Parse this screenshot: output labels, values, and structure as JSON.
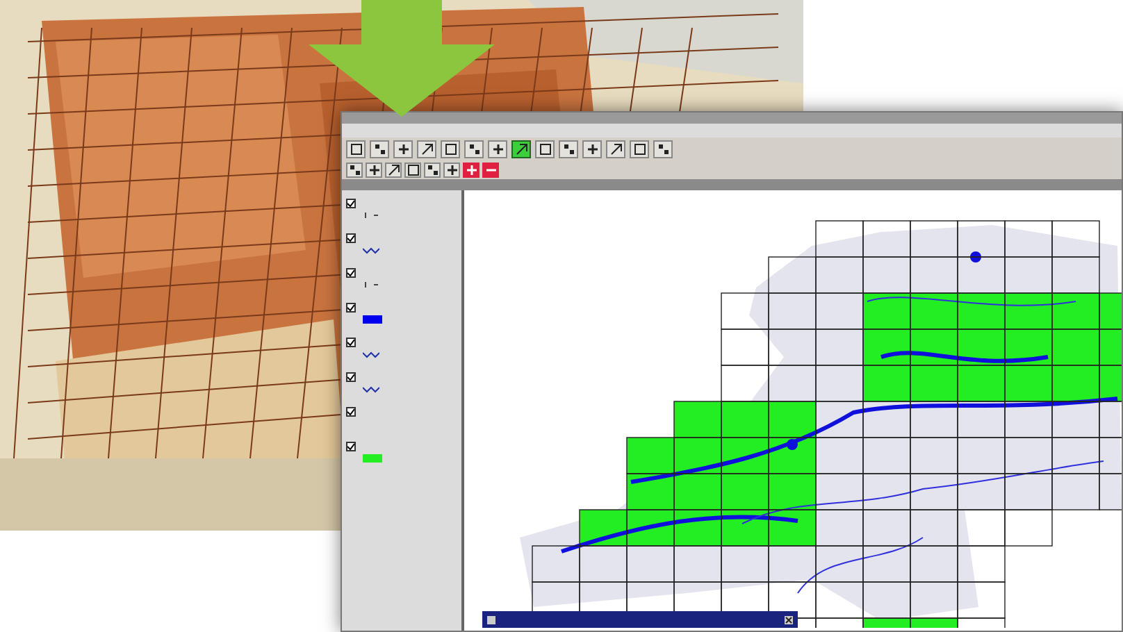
{
  "toolbar_top": [
    {
      "selected": false
    },
    {
      "selected": false
    },
    {
      "selected": false
    },
    {
      "selected": false
    },
    {
      "selected": false
    },
    {
      "selected": false
    },
    {
      "selected": false
    },
    {
      "selected": true
    },
    {
      "selected": false
    },
    {
      "selected": false
    },
    {
      "selected": false
    },
    {
      "selected": false
    },
    {
      "selected": false
    },
    {
      "selected": false
    }
  ],
  "toolbar_bottom": [
    {
      "kind": "tool"
    },
    {
      "kind": "tool"
    },
    {
      "kind": "tool"
    },
    {
      "kind": "tool"
    },
    {
      "kind": "tool"
    },
    {
      "kind": "tool"
    },
    {
      "kind": "zoom-in",
      "color": "#e02040"
    },
    {
      "kind": "zoom-out",
      "color": "#e02040"
    }
  ],
  "legend": [
    {
      "checked": true,
      "kind": "point"
    },
    {
      "checked": true,
      "kind": "line"
    },
    {
      "checked": true,
      "kind": "point"
    },
    {
      "checked": true,
      "kind": "fill",
      "color": "#0000ee"
    },
    {
      "checked": true,
      "kind": "line"
    },
    {
      "checked": true,
      "kind": "line"
    },
    {
      "checked": true,
      "kind": "none"
    },
    {
      "checked": true,
      "kind": "fill",
      "color": "#22ee22"
    }
  ]
}
